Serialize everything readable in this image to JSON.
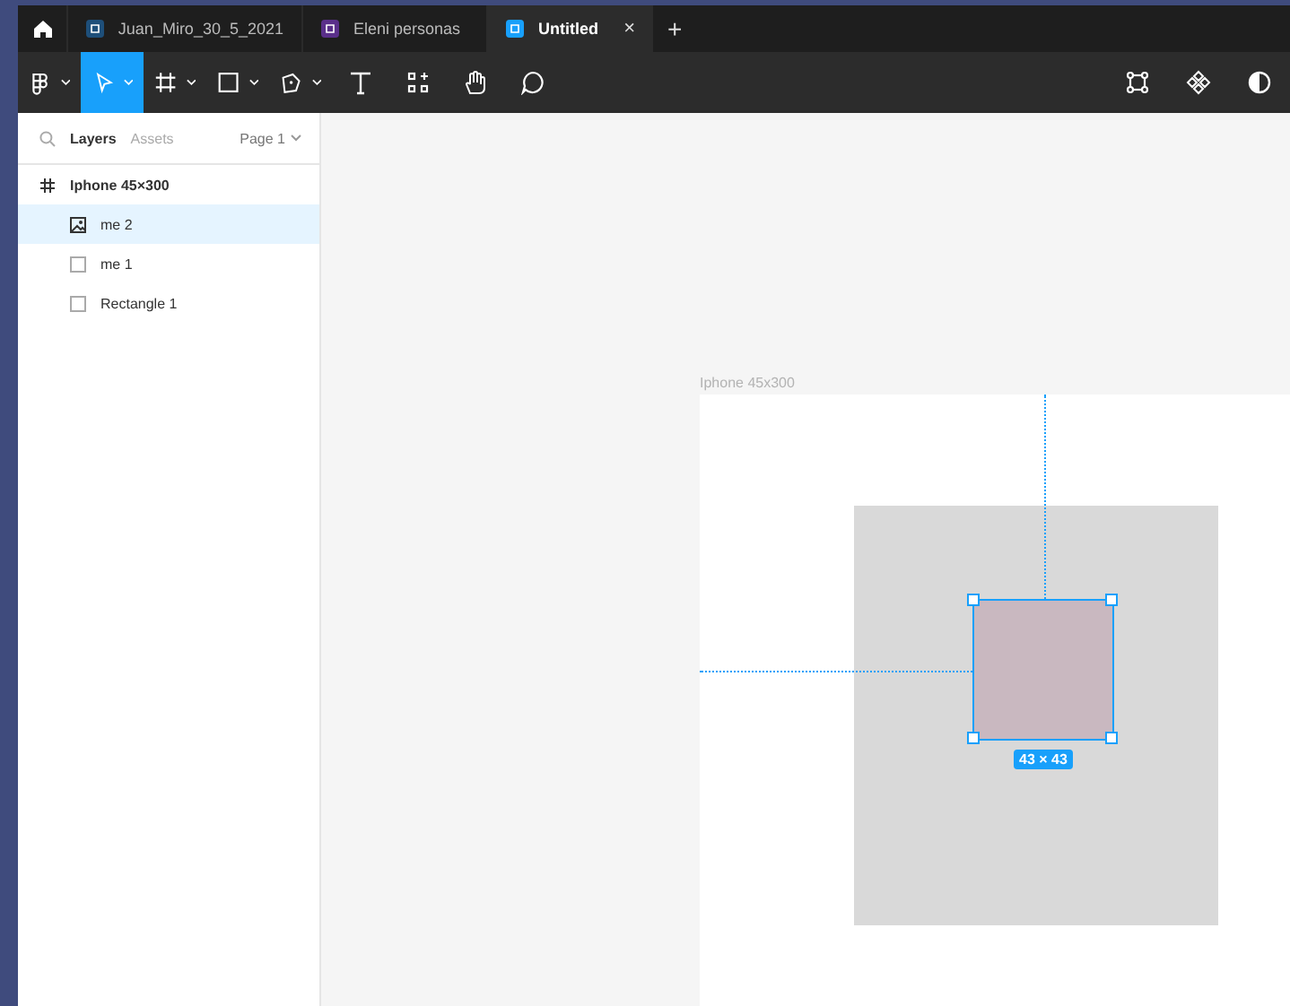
{
  "tabs": [
    {
      "kind": "home",
      "selected": false
    },
    {
      "kind": "file",
      "label": "Juan_Miro_30_5_2021",
      "color": "#1e4f7a",
      "selected": false,
      "closable": false
    },
    {
      "kind": "file",
      "label": "Eleni personas",
      "color": "#5a2f8a",
      "selected": false,
      "closable": false
    },
    {
      "kind": "file",
      "label": "Untitled",
      "color": "#18a0fb",
      "selected": true,
      "closable": true,
      "close": "×"
    },
    {
      "kind": "add",
      "label": "+"
    }
  ],
  "toolbar": {
    "tools": [
      {
        "kind": "main-menu",
        "selected": false,
        "dropdown": true
      },
      {
        "kind": "move",
        "selected": true,
        "dropdown": true
      },
      {
        "kind": "frame",
        "selected": false,
        "dropdown": true
      },
      {
        "kind": "rectangle",
        "selected": false,
        "dropdown": true
      },
      {
        "kind": "pen",
        "selected": false,
        "dropdown": true
      },
      {
        "kind": "text",
        "selected": false,
        "dropdown": false
      },
      {
        "kind": "resources",
        "selected": false,
        "dropdown": false
      },
      {
        "kind": "hand",
        "selected": false,
        "dropdown": false
      },
      {
        "kind": "comment",
        "selected": false,
        "dropdown": false
      }
    ],
    "right_tools": [
      {
        "kind": "component-outline"
      },
      {
        "kind": "component"
      },
      {
        "kind": "mask"
      }
    ]
  },
  "sidebar": {
    "tabs": [
      {
        "label": "Layers",
        "selected": true
      },
      {
        "label": "Assets",
        "selected": false
      }
    ],
    "page": "Page 1",
    "layers": [
      {
        "kind": "frame",
        "name": "Iphone 45×300",
        "selected": false,
        "children": [
          {
            "kind": "image",
            "name": "me 2",
            "selected": true
          },
          {
            "kind": "rectangle",
            "name": "me 1",
            "selected": false
          },
          {
            "kind": "rectangle",
            "name": "Rectangle 1",
            "selected": false
          }
        ]
      }
    ]
  },
  "canvas": {
    "frame_label": "Iphone 45x300",
    "selection_size": "43 × 43"
  }
}
